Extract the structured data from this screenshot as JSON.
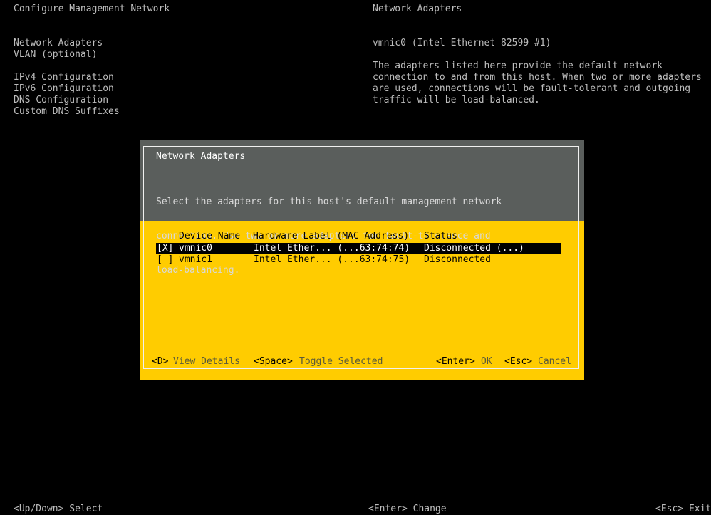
{
  "header": {
    "left_title": "Configure Management Network",
    "right_title": "Network Adapters"
  },
  "menu": {
    "items": [
      {
        "label": "Network Adapters"
      },
      {
        "label": "VLAN (optional)"
      },
      {
        "label": "IPv4 Configuration"
      },
      {
        "label": "IPv6 Configuration"
      },
      {
        "label": "DNS Configuration"
      },
      {
        "label": "Custom DNS Suffixes"
      }
    ]
  },
  "info": {
    "adapter": "vmnic0 (Intel Ethernet 82599 #1)",
    "description_lines": [
      "The adapters listed here provide the default network",
      "connection to and from this host. When two or more adapters",
      "are used, connections will be fault-tolerant and outgoing",
      "traffic will be load-balanced."
    ]
  },
  "dialog": {
    "title": "Network Adapters",
    "description_lines": [
      "Select the adapters for this host's default management network",
      "connection. Use two or more adapters for fault-tolerance and",
      "load-balancing."
    ],
    "columns": {
      "device": "Device Name",
      "hardware": "Hardware Label (MAC Address)",
      "status": "Status"
    },
    "rows": [
      {
        "check": "[X]",
        "device": "vmnic0",
        "hardware": "Intel Ether... (...63:74:74)",
        "status": "Disconnected (...)"
      },
      {
        "check": "[ ]",
        "device": "vmnic1",
        "hardware": "Intel Ether... (...63:74:75)",
        "status": "Disconnected"
      }
    ],
    "footer": {
      "details_key": "<D>",
      "details_label": "View Details",
      "toggle_key": "<Space>",
      "toggle_label": "Toggle Selected",
      "ok_key": "<Enter>",
      "ok_label": "OK",
      "cancel_key": "<Esc>",
      "cancel_label": "Cancel"
    }
  },
  "bottom_bar": {
    "left": "<Up/Down> Select",
    "middle": "<Enter> Change",
    "right": "<Esc> Exit"
  }
}
